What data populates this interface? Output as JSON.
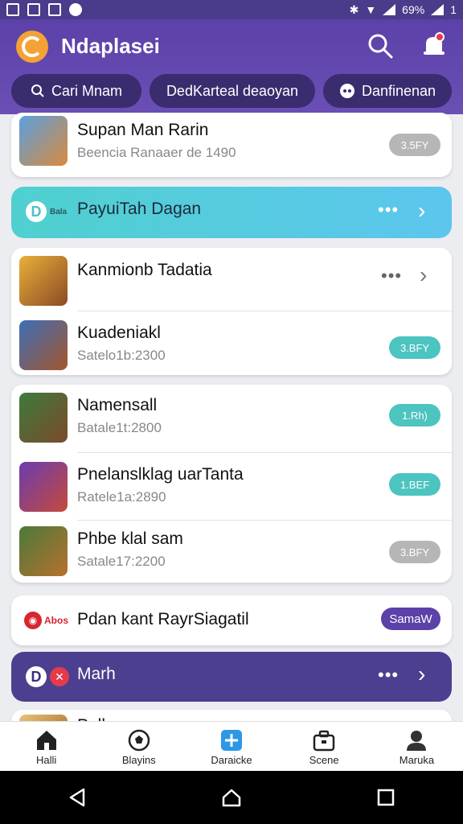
{
  "status_bar": {
    "battery": "69%",
    "signal": "1"
  },
  "header": {
    "title": "Ndaplasei",
    "chips": [
      {
        "label": "Cari Mnam",
        "icon": "search-icon"
      },
      {
        "label": "DedKarteal deaoyan",
        "icon": ""
      },
      {
        "label": "Danfinenan",
        "icon": "gamepad-icon"
      }
    ]
  },
  "top_card": {
    "title": "Supan Man Rarin",
    "subtitle": "Beencia Ranaaer de 1490",
    "pill": "3.5FY"
  },
  "banner_teal": {
    "logo_text": "D",
    "logo_tag": "Bala",
    "title": "PayuiTah Dagan"
  },
  "group1": [
    {
      "title": "Kanmionb Tadatia",
      "subtitle": "",
      "pill": "",
      "has_menu": true
    },
    {
      "title": "Kuadeniakl",
      "subtitle": "Satelo1b:2300",
      "pill": "3.BFY"
    }
  ],
  "group2": [
    {
      "title": "Namensall",
      "subtitle": "Batale1t:2800",
      "pill": "1.Rh)"
    },
    {
      "title": "Pnelanslklag uarTanta",
      "subtitle": "Ratele1a:2890",
      "pill": "1.BEF"
    },
    {
      "title": "Phbe klal sam",
      "subtitle": "Satale17:2200",
      "pill": "3.BFY"
    }
  ],
  "promo": {
    "logo_text": "Abos",
    "title": "Pdan kant RayrSiagatil",
    "button": "SamaW"
  },
  "banner_purple": {
    "logo_text": "D",
    "title": "Marh"
  },
  "peek_card": {
    "title": "Palkcam"
  },
  "bottom_nav": [
    {
      "label": "Halli",
      "icon": "home-icon"
    },
    {
      "label": "Blayins",
      "icon": "soccer-ball-icon"
    },
    {
      "label": "Daraicke",
      "icon": "plus-badge-icon"
    },
    {
      "label": "Scene",
      "icon": "briefcase-icon"
    },
    {
      "label": "Maruka",
      "icon": "profile-icon"
    }
  ],
  "colors": {
    "header": "#5b41a8",
    "chip": "#3a2c6e",
    "teal": "#4cc4c0",
    "purple_banner": "#4c3f8f",
    "teal_banner": "#5ad0e3"
  }
}
